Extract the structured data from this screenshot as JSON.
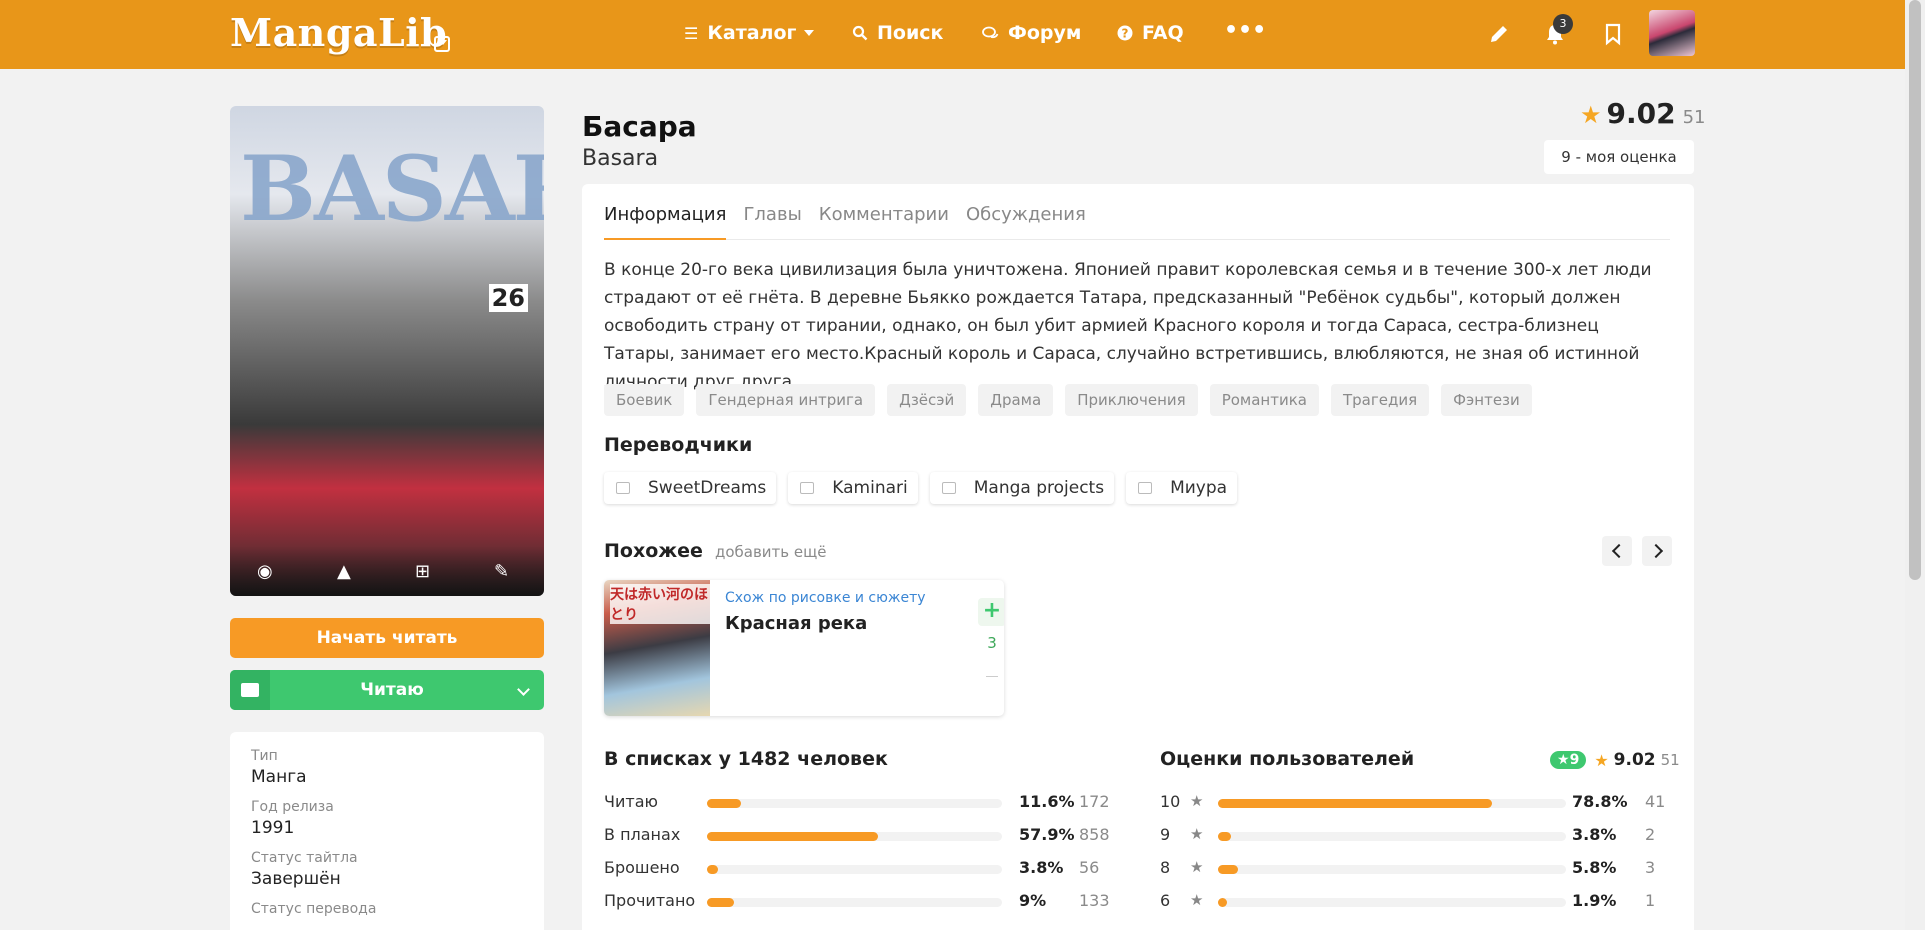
{
  "header": {
    "logo": "MangaLib",
    "nav": [
      {
        "label": "Каталог",
        "icon": "menu-icon"
      },
      {
        "label": "Поиск",
        "icon": "search-icon"
      },
      {
        "label": "Форум",
        "icon": "chat-icon"
      },
      {
        "label": "FAQ",
        "icon": "question-icon"
      }
    ],
    "notifications_count": "3",
    "accent": "#e89619"
  },
  "title": {
    "ru": "Басара",
    "en": "Basara"
  },
  "rating": {
    "value": "9.02",
    "count": "51",
    "my_rating": "9 - моя оценка"
  },
  "cover": {
    "title": "BASARA",
    "volume": "26"
  },
  "actions": {
    "start_reading": "Начать читать",
    "list_status": "Читаю"
  },
  "info": {
    "type_label": "Тип",
    "type_value": "Манга",
    "year_label": "Год релиза",
    "year_value": "1991",
    "status_label": "Статус тайтла",
    "status_value": "Завершён",
    "translation_label": "Статус перевода"
  },
  "tabs": [
    "Информация",
    "Главы",
    "Комментарии",
    "Обсуждения"
  ],
  "description": "В конце 20-го века цивилизация была уничтожена. Японией правит королевская семья и в течение 300-х лет люди страдают от её гнёта. В деревне Бьякко рождается Татара, предсказанный \"Ребёнок судьбы\", который должен освободить страну от тирании, однако, он был убит армией Красного короля и тогда Сараса, сестра-близнец Татары, занимает его место.Красный король и Сараса, случайно встретившись, влюбляются, не зная об истинной личности друг друга.",
  "genres": [
    "Боевик",
    "Гендерная интрига",
    "Дзёсэй",
    "Драма",
    "Приключения",
    "Романтика",
    "Трагедия",
    "Фэнтези"
  ],
  "translators": {
    "title": "Переводчики",
    "items": [
      "SweetDreams",
      "Kaminari",
      "Manga projects",
      "Миура"
    ]
  },
  "similar": {
    "title": "Похожее",
    "add_more": "добавить ещё",
    "items": [
      {
        "reason": "Схож по рисовке и сюжету",
        "name": "Красная река",
        "votes": "3",
        "cover_text": "天は赤い河のほとり"
      }
    ]
  },
  "lists": {
    "title": "В списках у 1482 человек",
    "rows": [
      {
        "label": "Читаю",
        "percent": "11.6%",
        "fraction": 0.116,
        "count": "172"
      },
      {
        "label": "В планах",
        "percent": "57.9%",
        "fraction": 0.579,
        "count": "858"
      },
      {
        "label": "Брошено",
        "percent": "3.8%",
        "fraction": 0.038,
        "count": "56"
      },
      {
        "label": "Прочитано",
        "percent": "9%",
        "fraction": 0.09,
        "count": "133"
      }
    ]
  },
  "user_ratings": {
    "title": "Оценки пользователей",
    "mine": "9",
    "avg": "9.02",
    "count": "51",
    "rows": [
      {
        "score": "10",
        "percent": "78.8%",
        "fraction": 0.788,
        "count": "41"
      },
      {
        "score": "9",
        "percent": "3.8%",
        "fraction": 0.038,
        "count": "2"
      },
      {
        "score": "8",
        "percent": "5.8%",
        "fraction": 0.058,
        "count": "3"
      },
      {
        "score": "6",
        "percent": "1.9%",
        "fraction": 0.019,
        "count": "1"
      }
    ]
  }
}
